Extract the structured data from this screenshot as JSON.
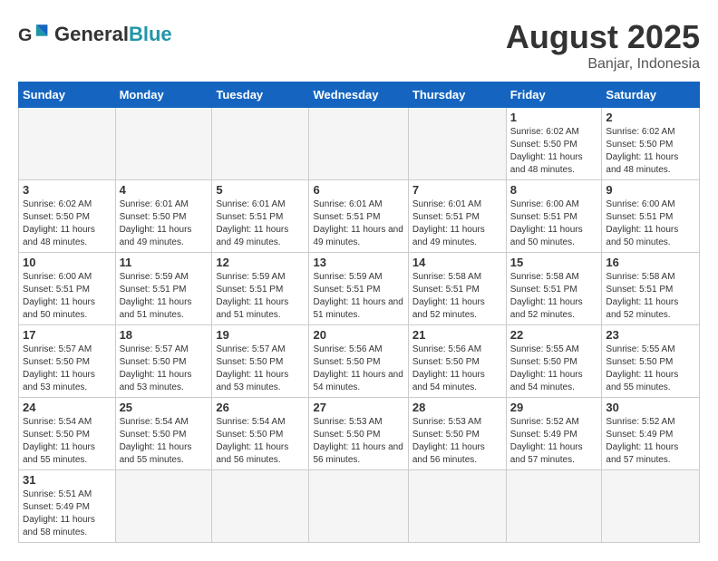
{
  "header": {
    "logo_general": "General",
    "logo_blue": "Blue",
    "month_year": "August 2025",
    "location": "Banjar, Indonesia"
  },
  "weekdays": [
    "Sunday",
    "Monday",
    "Tuesday",
    "Wednesday",
    "Thursday",
    "Friday",
    "Saturday"
  ],
  "weeks": [
    [
      {
        "day": "",
        "info": ""
      },
      {
        "day": "",
        "info": ""
      },
      {
        "day": "",
        "info": ""
      },
      {
        "day": "",
        "info": ""
      },
      {
        "day": "",
        "info": ""
      },
      {
        "day": "1",
        "info": "Sunrise: 6:02 AM\nSunset: 5:50 PM\nDaylight: 11 hours and 48 minutes."
      },
      {
        "day": "2",
        "info": "Sunrise: 6:02 AM\nSunset: 5:50 PM\nDaylight: 11 hours and 48 minutes."
      }
    ],
    [
      {
        "day": "3",
        "info": "Sunrise: 6:02 AM\nSunset: 5:50 PM\nDaylight: 11 hours and 48 minutes."
      },
      {
        "day": "4",
        "info": "Sunrise: 6:01 AM\nSunset: 5:50 PM\nDaylight: 11 hours and 49 minutes."
      },
      {
        "day": "5",
        "info": "Sunrise: 6:01 AM\nSunset: 5:51 PM\nDaylight: 11 hours and 49 minutes."
      },
      {
        "day": "6",
        "info": "Sunrise: 6:01 AM\nSunset: 5:51 PM\nDaylight: 11 hours and 49 minutes."
      },
      {
        "day": "7",
        "info": "Sunrise: 6:01 AM\nSunset: 5:51 PM\nDaylight: 11 hours and 49 minutes."
      },
      {
        "day": "8",
        "info": "Sunrise: 6:00 AM\nSunset: 5:51 PM\nDaylight: 11 hours and 50 minutes."
      },
      {
        "day": "9",
        "info": "Sunrise: 6:00 AM\nSunset: 5:51 PM\nDaylight: 11 hours and 50 minutes."
      }
    ],
    [
      {
        "day": "10",
        "info": "Sunrise: 6:00 AM\nSunset: 5:51 PM\nDaylight: 11 hours and 50 minutes."
      },
      {
        "day": "11",
        "info": "Sunrise: 5:59 AM\nSunset: 5:51 PM\nDaylight: 11 hours and 51 minutes."
      },
      {
        "day": "12",
        "info": "Sunrise: 5:59 AM\nSunset: 5:51 PM\nDaylight: 11 hours and 51 minutes."
      },
      {
        "day": "13",
        "info": "Sunrise: 5:59 AM\nSunset: 5:51 PM\nDaylight: 11 hours and 51 minutes."
      },
      {
        "day": "14",
        "info": "Sunrise: 5:58 AM\nSunset: 5:51 PM\nDaylight: 11 hours and 52 minutes."
      },
      {
        "day": "15",
        "info": "Sunrise: 5:58 AM\nSunset: 5:51 PM\nDaylight: 11 hours and 52 minutes."
      },
      {
        "day": "16",
        "info": "Sunrise: 5:58 AM\nSunset: 5:51 PM\nDaylight: 11 hours and 52 minutes."
      }
    ],
    [
      {
        "day": "17",
        "info": "Sunrise: 5:57 AM\nSunset: 5:50 PM\nDaylight: 11 hours and 53 minutes."
      },
      {
        "day": "18",
        "info": "Sunrise: 5:57 AM\nSunset: 5:50 PM\nDaylight: 11 hours and 53 minutes."
      },
      {
        "day": "19",
        "info": "Sunrise: 5:57 AM\nSunset: 5:50 PM\nDaylight: 11 hours and 53 minutes."
      },
      {
        "day": "20",
        "info": "Sunrise: 5:56 AM\nSunset: 5:50 PM\nDaylight: 11 hours and 54 minutes."
      },
      {
        "day": "21",
        "info": "Sunrise: 5:56 AM\nSunset: 5:50 PM\nDaylight: 11 hours and 54 minutes."
      },
      {
        "day": "22",
        "info": "Sunrise: 5:55 AM\nSunset: 5:50 PM\nDaylight: 11 hours and 54 minutes."
      },
      {
        "day": "23",
        "info": "Sunrise: 5:55 AM\nSunset: 5:50 PM\nDaylight: 11 hours and 55 minutes."
      }
    ],
    [
      {
        "day": "24",
        "info": "Sunrise: 5:54 AM\nSunset: 5:50 PM\nDaylight: 11 hours and 55 minutes."
      },
      {
        "day": "25",
        "info": "Sunrise: 5:54 AM\nSunset: 5:50 PM\nDaylight: 11 hours and 55 minutes."
      },
      {
        "day": "26",
        "info": "Sunrise: 5:54 AM\nSunset: 5:50 PM\nDaylight: 11 hours and 56 minutes."
      },
      {
        "day": "27",
        "info": "Sunrise: 5:53 AM\nSunset: 5:50 PM\nDaylight: 11 hours and 56 minutes."
      },
      {
        "day": "28",
        "info": "Sunrise: 5:53 AM\nSunset: 5:50 PM\nDaylight: 11 hours and 56 minutes."
      },
      {
        "day": "29",
        "info": "Sunrise: 5:52 AM\nSunset: 5:49 PM\nDaylight: 11 hours and 57 minutes."
      },
      {
        "day": "30",
        "info": "Sunrise: 5:52 AM\nSunset: 5:49 PM\nDaylight: 11 hours and 57 minutes."
      }
    ],
    [
      {
        "day": "31",
        "info": "Sunrise: 5:51 AM\nSunset: 5:49 PM\nDaylight: 11 hours and 58 minutes."
      },
      {
        "day": "",
        "info": ""
      },
      {
        "day": "",
        "info": ""
      },
      {
        "day": "",
        "info": ""
      },
      {
        "day": "",
        "info": ""
      },
      {
        "day": "",
        "info": ""
      },
      {
        "day": "",
        "info": ""
      }
    ]
  ]
}
